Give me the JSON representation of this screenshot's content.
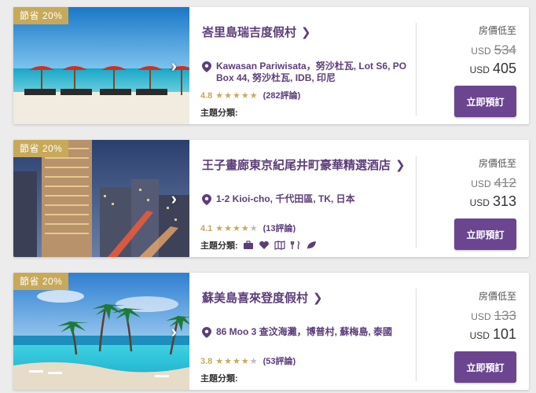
{
  "colors": {
    "accent": "#6b4590",
    "name": "#5c3d7a",
    "badge": "#c8a95a"
  },
  "hotels": [
    {
      "badge": "節省 20%",
      "name": "峇里島瑞吉度假村",
      "address": "Kawasan Pariwisata，努沙杜瓦, Lot S6, PO Box 44, 努沙杜瓦, IDB, 印尼",
      "score": "4.8",
      "stars": 5,
      "reviews": "(282評論)",
      "themes_label": "主題分類:",
      "themes": [],
      "price_label": "房價低至",
      "currency": "USD",
      "old_price": "534",
      "new_price": "405",
      "book_label": "立即預訂"
    },
    {
      "badge": "節省 20%",
      "name": "王子畫廊東京紀尾井町豪華精選酒店",
      "address": "1-2 Kioi-cho, 千代田區, TK, 日本",
      "score": "4.1",
      "stars": 4,
      "reviews": "(13評論)",
      "themes_label": "主題分類:",
      "themes": [
        "briefcase-icon",
        "heart-icon",
        "map-icon",
        "dining-icon",
        "leaf-icon"
      ],
      "price_label": "房價低至",
      "currency": "USD",
      "old_price": "412",
      "new_price": "313",
      "book_label": "立即預訂"
    },
    {
      "badge": "節省 20%",
      "name": "蘇美島喜來登度假村",
      "address": "86 Moo 3 查汶海灘，博普村, 蘇梅島, 泰國",
      "score": "3.8",
      "stars": 4,
      "reviews": "(53評論)",
      "themes_label": "主題分類:",
      "themes": [],
      "price_label": "房價低至",
      "currency": "USD",
      "old_price": "133",
      "new_price": "101",
      "book_label": "立即預訂"
    }
  ]
}
